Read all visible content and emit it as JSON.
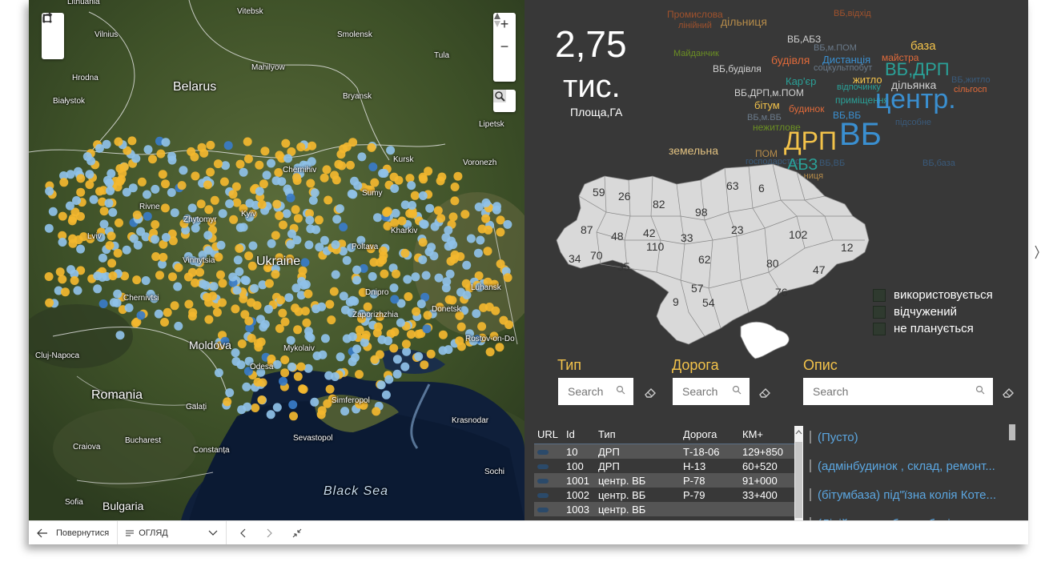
{
  "map": {
    "labels": {
      "lithuania": "Lithuania",
      "vitebsk": "Vitebsk",
      "vilnius": "Vilnius",
      "smolensk": "Smolensk",
      "tula": "Tula",
      "hrodna": "Hrodna",
      "mahilyow": "Mahilyow",
      "belarus": "Belarus",
      "bialystok": "Białystok",
      "bryansk": "Bryansk",
      "lipetsk": "Lipetsk",
      "kursk": "Kursk",
      "voronezh": "Voronezh",
      "chernihiv": "Chernihiv",
      "rivne": "Rivne",
      "sumy": "Sumy",
      "zhytomyr": "Zhytomyr",
      "kyiv": "Kyiv",
      "kharkiv": "Kharkiv",
      "lviv": "Lviv",
      "ukraine": "Ukraine",
      "poltava": "Poltava",
      "vinnytsia": "Vinnytsia",
      "luhansk": "Luhansk",
      "dnipro": "Dnipro",
      "chernivtsi": "Chernivtsi",
      "donetsk": "Donetsk",
      "zaporizhzhia": "Zaporizhzhia",
      "moldova": "Moldova",
      "clujnapoca": "Cluj-Napoca",
      "mykolaiv": "Mykolaiv",
      "rostov": "Rostov-on-Do",
      "odesa": "Odesa",
      "romania": "Romania",
      "simferopol": "Simferopol",
      "krasnodar": "Krasnodar",
      "galati": "Galați",
      "sevastopol": "Sevastopol",
      "bucharest": "Bucharest",
      "constanta": "Constanța",
      "craiova": "Craiova",
      "blacksea": "Black Sea",
      "sochi": "Sochi",
      "sofia": "Sofia",
      "bulgaria": "Bulgaria"
    },
    "zoom_in": "+",
    "zoom_out": "−"
  },
  "kpi": {
    "value": "2,75",
    "unit": "тис.",
    "label": "Площа,ГА"
  },
  "wordcloud": [
    {
      "t": "Промислова",
      "c": "#a0522d"
    },
    {
      "t": "лінійний",
      "c": "#a0522d"
    },
    {
      "t": "дільниця",
      "c": "#b58b4a"
    },
    {
      "t": "ВБ,відхід",
      "c": "#a0522d"
    },
    {
      "t": "ВБ,АБЗ",
      "c": "#d0d0d0"
    },
    {
      "t": "база",
      "c": "#f2c24a"
    },
    {
      "t": "ВБ,м.ПОМ",
      "c": "#6a7a8a"
    },
    {
      "t": "Майданчик",
      "c": "#6b8e23"
    },
    {
      "t": "будівля",
      "c": "#e06a3a"
    },
    {
      "t": "Дистанція",
      "c": "#3a8fd0"
    },
    {
      "t": "майстра",
      "c": "#e06a3a"
    },
    {
      "t": "соцкультпобут",
      "c": "#6a7a8a"
    },
    {
      "t": "ВБ,ДРП",
      "c": "#2aa198"
    },
    {
      "t": "ВБ,будівля",
      "c": "#d0d0d0"
    },
    {
      "t": "Кар'єр",
      "c": "#2aa198"
    },
    {
      "t": "житло",
      "c": "#f2c24a"
    },
    {
      "t": "дільянка",
      "c": "#d0d0d0"
    },
    {
      "t": "ВБ,ДРП,м.ПОМ",
      "c": "#d0d0d0"
    },
    {
      "t": "відпочинку",
      "c": "#2aa198"
    },
    {
      "t": "ВБ,житло",
      "c": "#3a5a7a"
    },
    {
      "t": "приміщення",
      "c": "#2aa198"
    },
    {
      "t": "сільгосп",
      "c": "#e06a3a"
    },
    {
      "t": "центр.",
      "c": "#3a8fd0"
    },
    {
      "t": "бітум",
      "c": "#f2c24a"
    },
    {
      "t": "будинок",
      "c": "#e06a3a"
    },
    {
      "t": "ВБ,ВБ",
      "c": "#3a8fd0"
    },
    {
      "t": "ВБ,м.ВБ",
      "c": "#6a7a8a"
    },
    {
      "t": "нежитлове",
      "c": "#6b8e23"
    },
    {
      "t": "підсобне",
      "c": "#3a5a7a"
    },
    {
      "t": "ДРП",
      "c": "#f2c24a"
    },
    {
      "t": "ВБ",
      "c": "#3a8fd0"
    },
    {
      "t": "земельна",
      "c": "#e0c080"
    },
    {
      "t": "ПОМ",
      "c": "#b58b4a"
    },
    {
      "t": "господарство",
      "c": "#3a5a7a"
    },
    {
      "t": "АБЗ",
      "c": "#2aa198"
    },
    {
      "t": "ВБ,ВБ",
      "c": "#3a5a7a"
    },
    {
      "t": "ВБ,база",
      "c": "#3a5a7a"
    },
    {
      "t": "ВБ,дільниця",
      "c": "#b58b4a"
    }
  ],
  "region_numbers": [
    "59",
    "26",
    "82",
    "63",
    "6",
    "98",
    "87",
    "48",
    "42",
    "33",
    "23",
    "102",
    "110",
    "34",
    "70",
    "35",
    "62",
    "12",
    "80",
    "47",
    "57",
    "76",
    "54",
    "9"
  ],
  "legend": [
    {
      "label": "використовується",
      "color": "#2f3a2f"
    },
    {
      "label": "відчужений",
      "color": "#2f3a2f"
    },
    {
      "label": "не планується",
      "color": "#2f3a2f"
    }
  ],
  "filters": [
    {
      "title": "Тип",
      "placeholder": "Search"
    },
    {
      "title": "Дорога",
      "placeholder": "Search"
    },
    {
      "title": "Опис",
      "placeholder": "Search"
    }
  ],
  "table": {
    "headers": [
      "URL",
      "Id",
      "Тип",
      "Дорога",
      "КМ+"
    ],
    "rows": [
      [
        "",
        "10",
        "ДРП",
        "Т-18-06",
        "129+850"
      ],
      [
        "",
        "100",
        "ДРП",
        "Н-13",
        "60+520"
      ],
      [
        "",
        "1001",
        "центр. ВБ",
        "Р-78",
        "91+000"
      ],
      [
        "",
        "1002",
        "центр. ВБ",
        "Р-79",
        "33+400"
      ],
      [
        "",
        "1003",
        "центр. ВБ",
        "",
        ""
      ]
    ]
  },
  "description_list": [
    "(Пусто)",
    "(адмінбудинок , склад, ремонт...",
    "(бітумбаза) під\"їзна колія Коте...",
    "(Лінійно-виробнича будівля, пр..."
  ],
  "bottom": {
    "back": "Повернутися",
    "page": "ОГЛЯД"
  },
  "colors": {
    "yellow_dot": "#f3b72f",
    "blue_dot": "#8fc1e8",
    "dark_blue_dot": "#3a7cc8",
    "accent": "#f2c24a",
    "link": "#5ba6e0"
  }
}
